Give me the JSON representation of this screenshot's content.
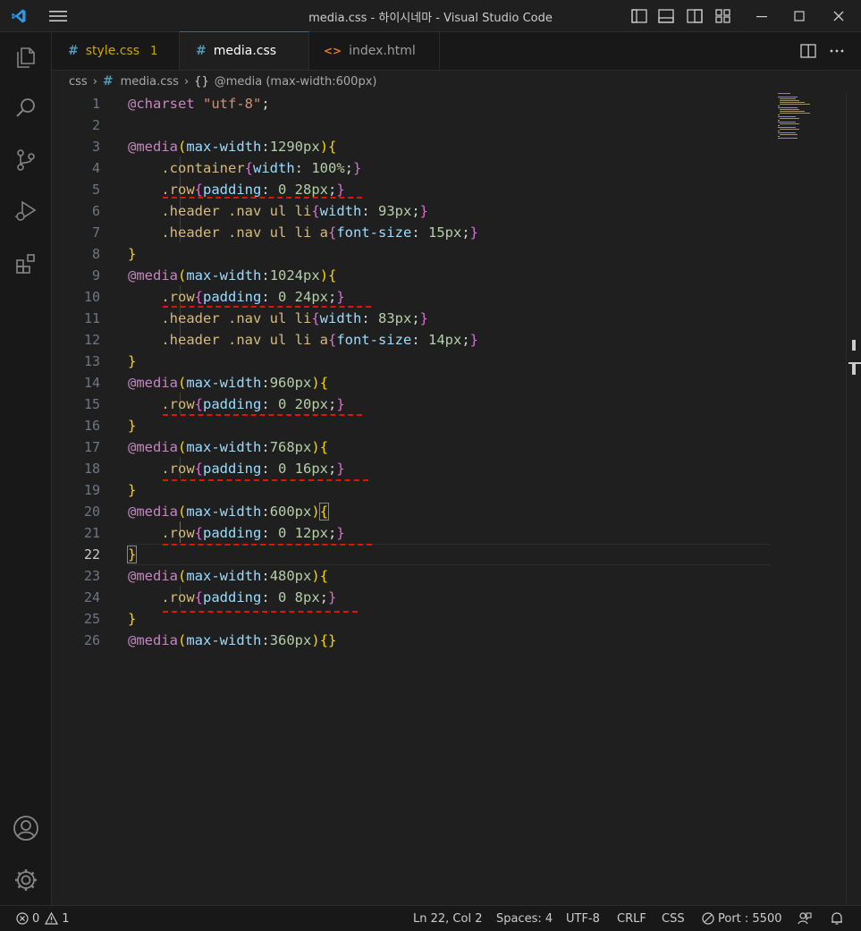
{
  "window": {
    "title": "media.css - 하이시네마 - Visual Studio Code"
  },
  "tabs": [
    {
      "label": "style.css",
      "badge": "1"
    },
    {
      "label": "media.css"
    },
    {
      "label": "index.html",
      "icon_glyph": "<>"
    }
  ],
  "breadcrumb": {
    "folder": "css",
    "file": "media.css",
    "symbol_icon": "{}",
    "symbol": "@media (max-width:600px)"
  },
  "editor": {
    "lines": [
      {
        "n": "1",
        "tokens": [
          {
            "t": "@charset",
            "c": "t-at"
          },
          {
            "t": " ",
            "c": "t-p"
          },
          {
            "t": "\"utf-8\"",
            "c": "t-str"
          },
          {
            "t": ";",
            "c": "t-p"
          }
        ]
      },
      {
        "n": "2",
        "tokens": []
      },
      {
        "n": "3",
        "tokens": [
          {
            "t": "@media",
            "c": "t-at"
          },
          {
            "t": "(",
            "c": "t-b1"
          },
          {
            "t": "max-width",
            "c": "t-prop"
          },
          {
            "t": ":",
            "c": "t-p"
          },
          {
            "t": "1290px",
            "c": "t-num"
          },
          {
            "t": ")",
            "c": "t-b1"
          },
          {
            "t": "{",
            "c": "t-b1"
          }
        ]
      },
      {
        "n": "4",
        "tokens": [
          {
            "t": "    ",
            "c": "t-p"
          },
          {
            "t": ".container",
            "c": "t-sel"
          },
          {
            "t": "{",
            "c": "t-b2"
          },
          {
            "t": "width",
            "c": "t-prop"
          },
          {
            "t": ": ",
            "c": "t-p"
          },
          {
            "t": "100%",
            "c": "t-num"
          },
          {
            "t": ";",
            "c": "t-p"
          },
          {
            "t": "}",
            "c": "t-b2"
          }
        ]
      },
      {
        "n": "5",
        "tokens": [
          {
            "t": "    ",
            "c": "t-p"
          },
          {
            "t": ".row",
            "c": "t-sel"
          },
          {
            "t": "{",
            "c": "t-b2"
          },
          {
            "t": "padding",
            "c": "t-prop"
          },
          {
            "t": ": ",
            "c": "t-p"
          },
          {
            "t": "0 28px",
            "c": "t-num"
          },
          {
            "t": ";",
            "c": "t-p"
          },
          {
            "t": "}",
            "c": "t-b2"
          }
        ]
      },
      {
        "n": "6",
        "tokens": [
          {
            "t": "    ",
            "c": "t-p"
          },
          {
            "t": ".header .nav ul li",
            "c": "t-sel"
          },
          {
            "t": "{",
            "c": "t-b2"
          },
          {
            "t": "width",
            "c": "t-prop"
          },
          {
            "t": ": ",
            "c": "t-p"
          },
          {
            "t": "93px",
            "c": "t-num"
          },
          {
            "t": ";",
            "c": "t-p"
          },
          {
            "t": "}",
            "c": "t-b2"
          }
        ]
      },
      {
        "n": "7",
        "tokens": [
          {
            "t": "    ",
            "c": "t-p"
          },
          {
            "t": ".header .nav ul li a",
            "c": "t-sel"
          },
          {
            "t": "{",
            "c": "t-b2"
          },
          {
            "t": "font-size",
            "c": "t-prop"
          },
          {
            "t": ": ",
            "c": "t-p"
          },
          {
            "t": "15px",
            "c": "t-num"
          },
          {
            "t": ";",
            "c": "t-p"
          },
          {
            "t": "}",
            "c": "t-b2"
          }
        ]
      },
      {
        "n": "8",
        "tokens": [
          {
            "t": "}",
            "c": "t-b1"
          }
        ]
      },
      {
        "n": "9",
        "tokens": [
          {
            "t": "@media",
            "c": "t-at"
          },
          {
            "t": "(",
            "c": "t-b1"
          },
          {
            "t": "max-width",
            "c": "t-prop"
          },
          {
            "t": ":",
            "c": "t-p"
          },
          {
            "t": "1024px",
            "c": "t-num"
          },
          {
            "t": ")",
            "c": "t-b1"
          },
          {
            "t": "{",
            "c": "t-b1"
          }
        ]
      },
      {
        "n": "10",
        "tokens": [
          {
            "t": "    ",
            "c": "t-p"
          },
          {
            "t": ".row",
            "c": "t-sel"
          },
          {
            "t": "{",
            "c": "t-b2"
          },
          {
            "t": "padding",
            "c": "t-prop"
          },
          {
            "t": ": ",
            "c": "t-p"
          },
          {
            "t": "0 24px",
            "c": "t-num"
          },
          {
            "t": ";",
            "c": "t-p"
          },
          {
            "t": "}",
            "c": "t-b2"
          }
        ]
      },
      {
        "n": "11",
        "tokens": [
          {
            "t": "    ",
            "c": "t-p"
          },
          {
            "t": ".header .nav ul li",
            "c": "t-sel"
          },
          {
            "t": "{",
            "c": "t-b2"
          },
          {
            "t": "width",
            "c": "t-prop"
          },
          {
            "t": ": ",
            "c": "t-p"
          },
          {
            "t": "83px",
            "c": "t-num"
          },
          {
            "t": ";",
            "c": "t-p"
          },
          {
            "t": "}",
            "c": "t-b2"
          }
        ]
      },
      {
        "n": "12",
        "tokens": [
          {
            "t": "    ",
            "c": "t-p"
          },
          {
            "t": ".header .nav ul li a",
            "c": "t-sel"
          },
          {
            "t": "{",
            "c": "t-b2"
          },
          {
            "t": "font-size",
            "c": "t-prop"
          },
          {
            "t": ": ",
            "c": "t-p"
          },
          {
            "t": "14px",
            "c": "t-num"
          },
          {
            "t": ";",
            "c": "t-p"
          },
          {
            "t": "}",
            "c": "t-b2"
          }
        ]
      },
      {
        "n": "13",
        "tokens": [
          {
            "t": "}",
            "c": "t-b1"
          }
        ]
      },
      {
        "n": "14",
        "tokens": [
          {
            "t": "@media",
            "c": "t-at"
          },
          {
            "t": "(",
            "c": "t-b1"
          },
          {
            "t": "max-width",
            "c": "t-prop"
          },
          {
            "t": ":",
            "c": "t-p"
          },
          {
            "t": "960px",
            "c": "t-num"
          },
          {
            "t": ")",
            "c": "t-b1"
          },
          {
            "t": "{",
            "c": "t-b1"
          }
        ]
      },
      {
        "n": "15",
        "tokens": [
          {
            "t": "    ",
            "c": "t-p"
          },
          {
            "t": ".row",
            "c": "t-sel"
          },
          {
            "t": "{",
            "c": "t-b2"
          },
          {
            "t": "padding",
            "c": "t-prop"
          },
          {
            "t": ": ",
            "c": "t-p"
          },
          {
            "t": "0 20px",
            "c": "t-num"
          },
          {
            "t": ";",
            "c": "t-p"
          },
          {
            "t": "}",
            "c": "t-b2"
          }
        ]
      },
      {
        "n": "16",
        "tokens": [
          {
            "t": "}",
            "c": "t-b1"
          }
        ]
      },
      {
        "n": "17",
        "tokens": [
          {
            "t": "@media",
            "c": "t-at"
          },
          {
            "t": "(",
            "c": "t-b1"
          },
          {
            "t": "max-width",
            "c": "t-prop"
          },
          {
            "t": ":",
            "c": "t-p"
          },
          {
            "t": "768px",
            "c": "t-num"
          },
          {
            "t": ")",
            "c": "t-b1"
          },
          {
            "t": "{",
            "c": "t-b1"
          }
        ]
      },
      {
        "n": "18",
        "tokens": [
          {
            "t": "    ",
            "c": "t-p"
          },
          {
            "t": ".row",
            "c": "t-sel"
          },
          {
            "t": "{",
            "c": "t-b2"
          },
          {
            "t": "padding",
            "c": "t-prop"
          },
          {
            "t": ": ",
            "c": "t-p"
          },
          {
            "t": "0 16px",
            "c": "t-num"
          },
          {
            "t": ";",
            "c": "t-p"
          },
          {
            "t": "}",
            "c": "t-b2"
          }
        ]
      },
      {
        "n": "19",
        "tokens": [
          {
            "t": "}",
            "c": "t-b1"
          }
        ]
      },
      {
        "n": "20",
        "tokens": [
          {
            "t": "@media",
            "c": "t-at"
          },
          {
            "t": "(",
            "c": "t-b1"
          },
          {
            "t": "max-width",
            "c": "t-prop"
          },
          {
            "t": ":",
            "c": "t-p"
          },
          {
            "t": "600px",
            "c": "t-num"
          },
          {
            "t": ")",
            "c": "t-b1"
          },
          {
            "t": "{",
            "c": "t-b1"
          }
        ]
      },
      {
        "n": "21",
        "tokens": [
          {
            "t": "    ",
            "c": "t-p"
          },
          {
            "t": ".row",
            "c": "t-sel"
          },
          {
            "t": "{",
            "c": "t-b2"
          },
          {
            "t": "padding",
            "c": "t-prop"
          },
          {
            "t": ": ",
            "c": "t-p"
          },
          {
            "t": "0 12px",
            "c": "t-num"
          },
          {
            "t": ";",
            "c": "t-p"
          },
          {
            "t": "}",
            "c": "t-b2"
          }
        ]
      },
      {
        "n": "22",
        "tokens": [
          {
            "t": "}",
            "c": "t-b1"
          }
        ]
      },
      {
        "n": "23",
        "tokens": [
          {
            "t": "@media",
            "c": "t-at"
          },
          {
            "t": "(",
            "c": "t-b1"
          },
          {
            "t": "max-width",
            "c": "t-prop"
          },
          {
            "t": ":",
            "c": "t-p"
          },
          {
            "t": "480px",
            "c": "t-num"
          },
          {
            "t": ")",
            "c": "t-b1"
          },
          {
            "t": "{",
            "c": "t-b1"
          }
        ]
      },
      {
        "n": "24",
        "tokens": [
          {
            "t": "    ",
            "c": "t-p"
          },
          {
            "t": ".row",
            "c": "t-sel"
          },
          {
            "t": "{",
            "c": "t-b2"
          },
          {
            "t": "padding",
            "c": "t-prop"
          },
          {
            "t": ": ",
            "c": "t-p"
          },
          {
            "t": "0 8px",
            "c": "t-num"
          },
          {
            "t": ";",
            "c": "t-p"
          },
          {
            "t": "}",
            "c": "t-b2"
          }
        ]
      },
      {
        "n": "25",
        "tokens": [
          {
            "t": "}",
            "c": "t-b1"
          }
        ]
      },
      {
        "n": "26",
        "tokens": [
          {
            "t": "@media",
            "c": "t-at"
          },
          {
            "t": "(",
            "c": "t-b1"
          },
          {
            "t": "max-width",
            "c": "t-prop"
          },
          {
            "t": ":",
            "c": "t-p"
          },
          {
            "t": "360px",
            "c": "t-num"
          },
          {
            "t": ")",
            "c": "t-b1"
          },
          {
            "t": "{}",
            "c": "t-b1"
          }
        ]
      }
    ]
  },
  "status": {
    "errors": "0",
    "warnings": "1",
    "position": "Ln 22, Col 2",
    "spaces": "Spaces: 4",
    "encoding": "UTF-8",
    "eol": "CRLF",
    "language": "CSS",
    "port": "Port : 5500"
  },
  "colors": {
    "accent": "#0078d4",
    "warning_tab": "#cca700",
    "error_squiggle": "#e51400"
  }
}
